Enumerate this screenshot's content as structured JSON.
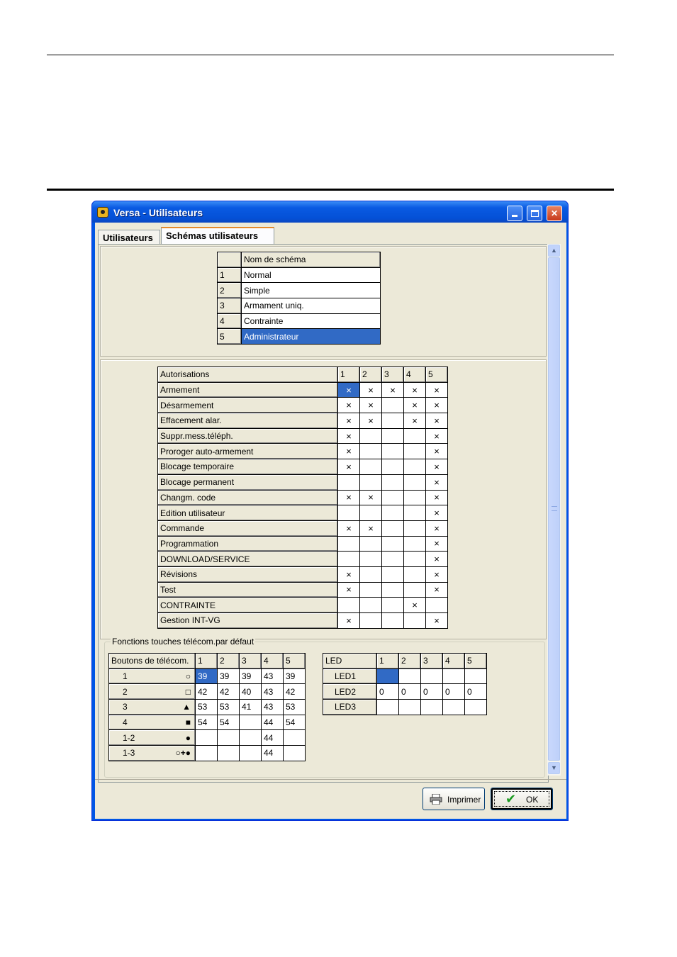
{
  "window": {
    "title": "Versa - Utilisateurs"
  },
  "tabs": [
    {
      "label": "Utilisateurs"
    },
    {
      "label": "Schémas utilisateurs"
    }
  ],
  "schemes": {
    "header": "Nom de schéma",
    "rows": [
      {
        "num": "1",
        "name": "Normal"
      },
      {
        "num": "2",
        "name": "Simple"
      },
      {
        "num": "3",
        "name": "Armament uniq."
      },
      {
        "num": "4",
        "name": "Contrainte"
      },
      {
        "num": "5",
        "name": "Administrateur"
      }
    ],
    "selected": 5
  },
  "rights": {
    "header": "Autorisations",
    "columns": [
      "1",
      "2",
      "3",
      "4",
      "5"
    ],
    "mark": "×",
    "rows": [
      {
        "label": "Armement",
        "marks": [
          1,
          1,
          1,
          1,
          1
        ]
      },
      {
        "label": "Désarmement",
        "marks": [
          1,
          1,
          0,
          1,
          1
        ]
      },
      {
        "label": "Effacement alar.",
        "marks": [
          1,
          1,
          0,
          1,
          1
        ]
      },
      {
        "label": "Suppr.mess.téléph.",
        "marks": [
          1,
          0,
          0,
          0,
          1
        ]
      },
      {
        "label": "Proroger auto-armement",
        "marks": [
          1,
          0,
          0,
          0,
          1
        ]
      },
      {
        "label": "Blocage temporaire",
        "marks": [
          1,
          0,
          0,
          0,
          1
        ]
      },
      {
        "label": "Blocage permanent",
        "marks": [
          0,
          0,
          0,
          0,
          1
        ]
      },
      {
        "label": "Changm. code",
        "marks": [
          1,
          1,
          0,
          0,
          1
        ]
      },
      {
        "label": "Edition utilisateur",
        "marks": [
          0,
          0,
          0,
          0,
          1
        ]
      },
      {
        "label": "Commande",
        "marks": [
          1,
          1,
          0,
          0,
          1
        ]
      },
      {
        "label": "Programmation",
        "marks": [
          0,
          0,
          0,
          0,
          1
        ]
      },
      {
        "label": "DOWNLOAD/SERVICE",
        "marks": [
          0,
          0,
          0,
          0,
          1
        ]
      },
      {
        "label": "Révisions",
        "marks": [
          1,
          0,
          0,
          0,
          1
        ]
      },
      {
        "label": "Test",
        "marks": [
          1,
          0,
          0,
          0,
          1
        ]
      },
      {
        "label": "CONTRAINTE",
        "marks": [
          0,
          0,
          0,
          1,
          0
        ]
      },
      {
        "label": "Gestion INT-VG",
        "marks": [
          1,
          0,
          0,
          0,
          1
        ]
      }
    ]
  },
  "remote": {
    "group_label": "Fonctions touches télécom.par défaut",
    "header": "Boutons de télécom.",
    "columns": [
      "1",
      "2",
      "3",
      "4",
      "5"
    ],
    "rows": [
      {
        "key": "1",
        "symbol": "○",
        "values": [
          "39",
          "39",
          "39",
          "43",
          "39"
        ]
      },
      {
        "key": "2",
        "symbol": "□",
        "values": [
          "42",
          "42",
          "40",
          "43",
          "42"
        ]
      },
      {
        "key": "3",
        "symbol": "▲",
        "values": [
          "53",
          "53",
          "41",
          "43",
          "53"
        ]
      },
      {
        "key": "4",
        "symbol": "■",
        "values": [
          "54",
          "54",
          "",
          "44",
          "54"
        ]
      },
      {
        "key": "1-2",
        "symbol": "●",
        "values": [
          "",
          "",
          "",
          "44",
          ""
        ]
      },
      {
        "key": "1-3",
        "symbol": "○+●",
        "values": [
          "",
          "",
          "",
          "44",
          ""
        ]
      }
    ]
  },
  "led": {
    "header": "LED",
    "columns": [
      "1",
      "2",
      "3",
      "4",
      "5"
    ],
    "rows": [
      {
        "label": "LED1",
        "values": [
          "",
          "",
          "",
          "",
          ""
        ]
      },
      {
        "label": "LED2",
        "values": [
          "0",
          "0",
          "0",
          "0",
          "0"
        ]
      },
      {
        "label": "LED3",
        "values": [
          "",
          "",
          "",
          "",
          ""
        ]
      }
    ]
  },
  "buttons": {
    "print": "Imprimer",
    "ok": "OK"
  },
  "icons": {
    "app": "versa-app-icon",
    "print": "printer-icon",
    "ok": "checkmark-icon"
  }
}
